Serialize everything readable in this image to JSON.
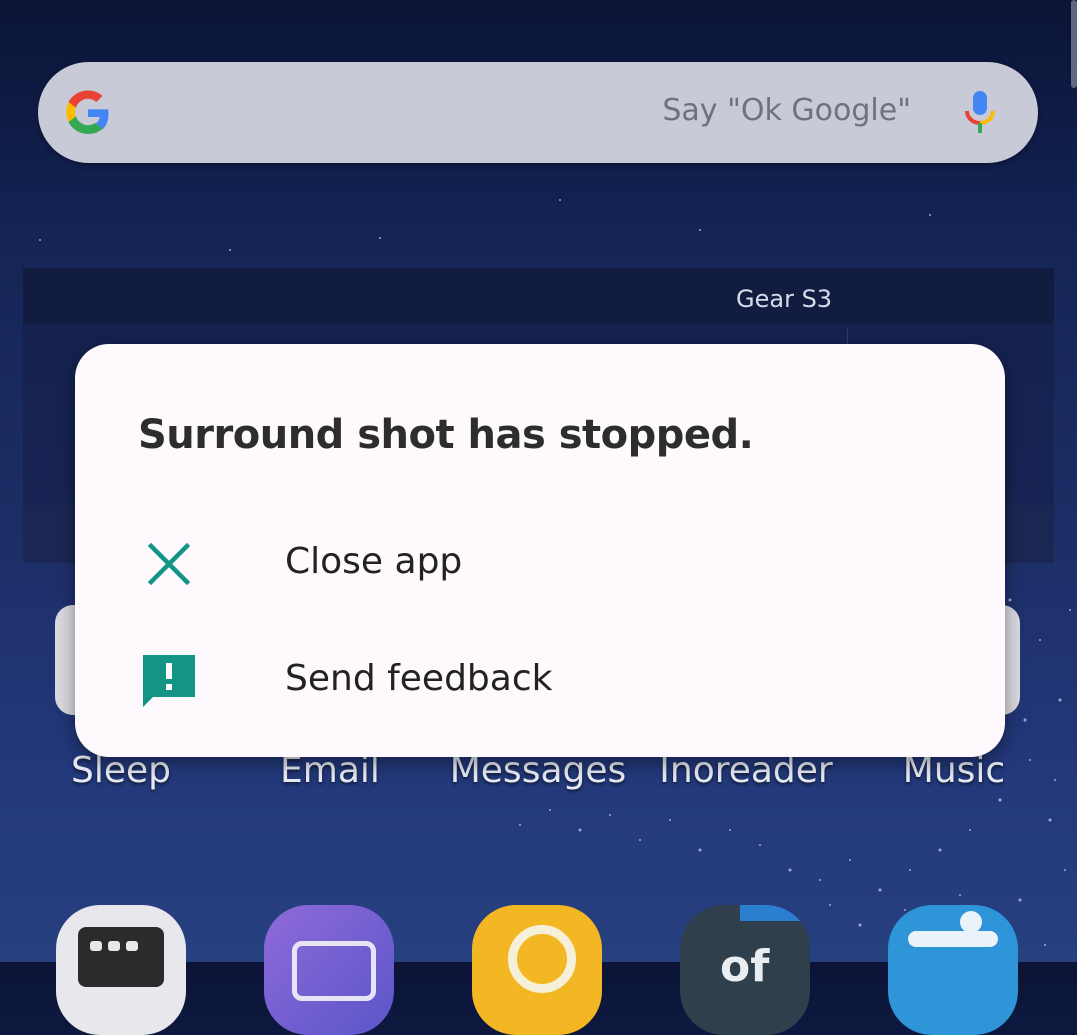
{
  "search": {
    "hint": "Say \"Ok Google\"",
    "logo_icon": "google-g-icon",
    "mic_icon": "mic-icon"
  },
  "widget": {
    "title": "Gear S3"
  },
  "apps": {
    "row_labels": [
      "Sleep",
      "Email",
      "Messages",
      "Inoreader",
      "Music"
    ],
    "bottom_icons": [
      "blackberry-icon",
      "camera-icon",
      "search-app-icon",
      "of-app-icon",
      "sport-app-icon"
    ]
  },
  "dialog": {
    "title": "Surround shot has stopped.",
    "options": [
      {
        "label": "Close app",
        "icon": "close-icon"
      },
      {
        "label": "Send feedback",
        "icon": "feedback-icon"
      }
    ],
    "accent_color": "#149484"
  },
  "colors": {
    "dialog_bg": "#fdf9fd",
    "wallpaper": "#1d2e66"
  }
}
